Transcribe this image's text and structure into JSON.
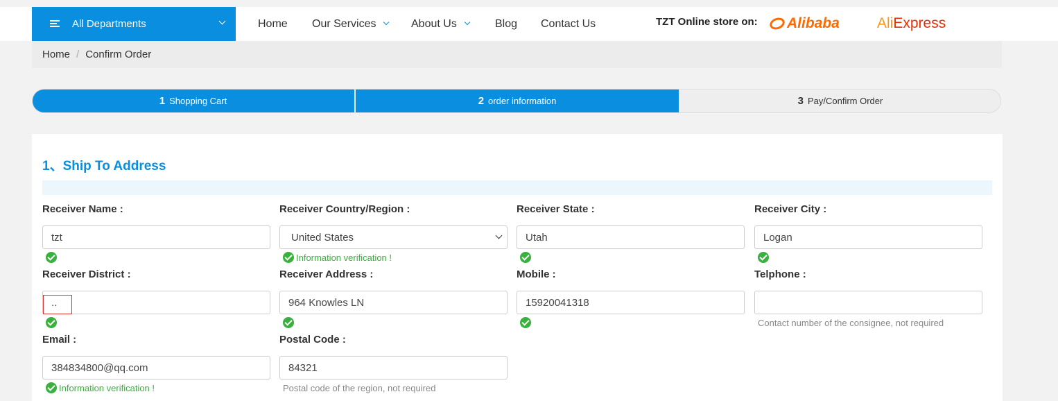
{
  "header": {
    "departments_label": "All Departments",
    "nav": [
      {
        "label": "Home",
        "dropdown": false
      },
      {
        "label": "Our Services",
        "dropdown": true
      },
      {
        "label": "About Us",
        "dropdown": true
      },
      {
        "label": "Blog",
        "dropdown": false
      },
      {
        "label": "Contact Us",
        "dropdown": false
      }
    ],
    "store_label": "TZT Online store on:",
    "alibaba": "Alibaba",
    "aliexpress_ali": "Ali",
    "aliexpress_express": "Express"
  },
  "breadcrumb": {
    "home": "Home",
    "separator": "/",
    "current": "Confirm Order"
  },
  "steps": [
    {
      "num": "1",
      "label": "Shopping Cart",
      "active": true
    },
    {
      "num": "2",
      "label": "order information",
      "active": true
    },
    {
      "num": "3",
      "label": "Pay/Confirm Order",
      "active": false
    }
  ],
  "form": {
    "section_title": "1、Ship To Address",
    "receiver_name": {
      "label": "Receiver Name :",
      "value": "tzt"
    },
    "country": {
      "label": "Receiver Country/Region :",
      "value": "United States",
      "message": "Information verification !"
    },
    "state": {
      "label": "Receiver State :",
      "value": "Utah"
    },
    "city": {
      "label": "Receiver City :",
      "value": "Logan"
    },
    "district": {
      "label": "Receiver District :",
      "value": ".."
    },
    "address": {
      "label": "Receiver Address :",
      "value": "964 Knowles LN"
    },
    "mobile": {
      "label": "Mobile :",
      "value": "15920041318"
    },
    "telephone": {
      "label": "Telphone :",
      "value": "",
      "hint": "Contact number of the consignee, not required"
    },
    "email": {
      "label": "Email :",
      "value": "384834800@qq.com",
      "message": "Information verification !"
    },
    "postal": {
      "label": "Postal Code :",
      "value": "84321",
      "hint": "Postal code of the region, not required"
    }
  },
  "colors": {
    "brand": "#0a8ee0",
    "success": "#3ab03e",
    "alibaba": "#ff6a00",
    "aliexpress": "#e62e04"
  }
}
